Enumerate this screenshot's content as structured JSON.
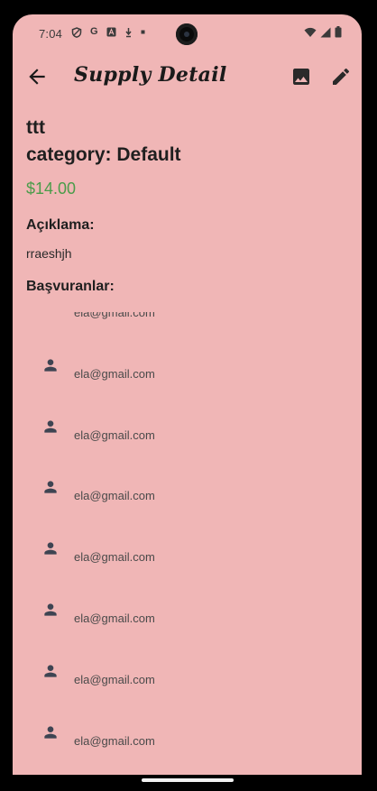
{
  "status_bar": {
    "time": "7:04",
    "left_icons": [
      "shield-icon",
      "google-icon",
      "font-icon",
      "download-icon",
      "dot-icon"
    ],
    "right_icons": [
      "wifi-icon",
      "signal-icon",
      "battery-icon"
    ]
  },
  "app_bar": {
    "title": "Supply Detail",
    "actions": [
      "image-icon",
      "edit-icon"
    ]
  },
  "supply": {
    "name": "ttt",
    "category": "category: Default",
    "price": "$14.00",
    "price_color": "#4a9c4a",
    "description_label": "Açıklama:",
    "description": "rraeshjh",
    "applicants_label": "Başvuranlar:",
    "applicants": [
      {
        "email": "ela@gmail.com"
      },
      {
        "email": "ela@gmail.com"
      },
      {
        "email": "ela@gmail.com"
      },
      {
        "email": "ela@gmail.com"
      },
      {
        "email": "ela@gmail.com"
      },
      {
        "email": "ela@gmail.com"
      },
      {
        "email": "ela@gmail.com"
      },
      {
        "email": "ela@gmail.com"
      }
    ]
  },
  "theme": {
    "background": "#f0b6b6"
  }
}
